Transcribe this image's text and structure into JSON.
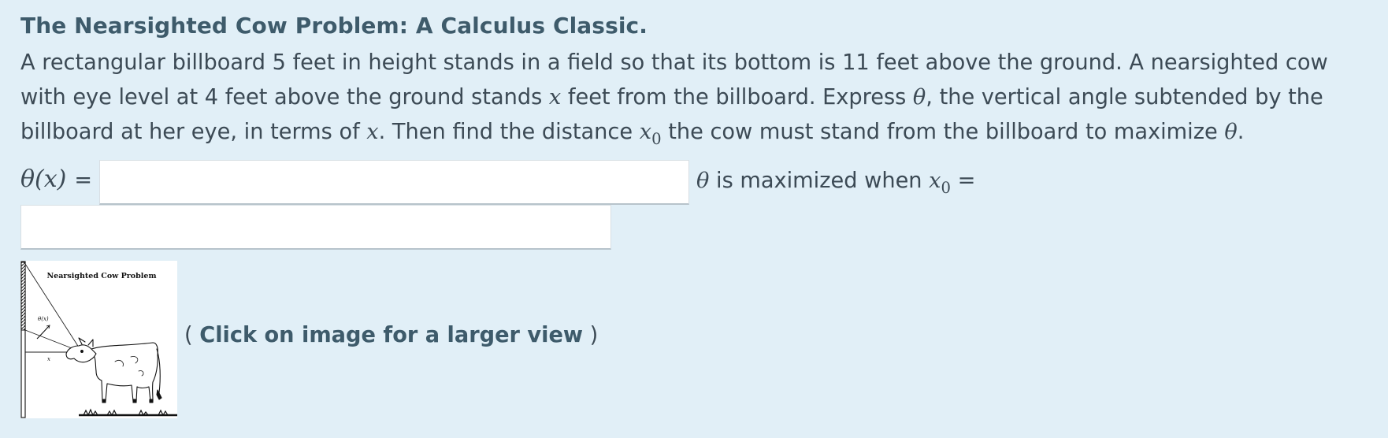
{
  "title": "The Nearsighted Cow Problem: A Calculus Classic.",
  "problem": {
    "part1": "A rectangular billboard 5 feet in height stands in a field so that its bottom is 11 feet above the ground. A nearsighted cow with eye level at 4 feet above the ground stands ",
    "var_x": "x",
    "part2": " feet from the billboard. Express ",
    "var_theta": "θ",
    "part3": ", the vertical angle subtended by the billboard at her eye, in terms of ",
    "part4": ". Then find the distance ",
    "var_x0_base": "x",
    "var_x0_sub": "0",
    "part5": " the cow must stand from the billboard to maximize ",
    "part6": "."
  },
  "answer": {
    "theta_label": "θ(x)",
    "equals": "=",
    "theta_input_value": "",
    "max_prefix_theta": "θ",
    "max_text": " is maximized when ",
    "x0_base": "x",
    "x0_sub": "0",
    "max_equals": " =",
    "x0_input_value": ""
  },
  "figure": {
    "caption": "Nearsighted Cow Problem",
    "angle_label": "θ(x)",
    "distance_label": "x"
  },
  "click_note": {
    "open": "( ",
    "bold": "Click on image for a larger view",
    "close": " )"
  }
}
